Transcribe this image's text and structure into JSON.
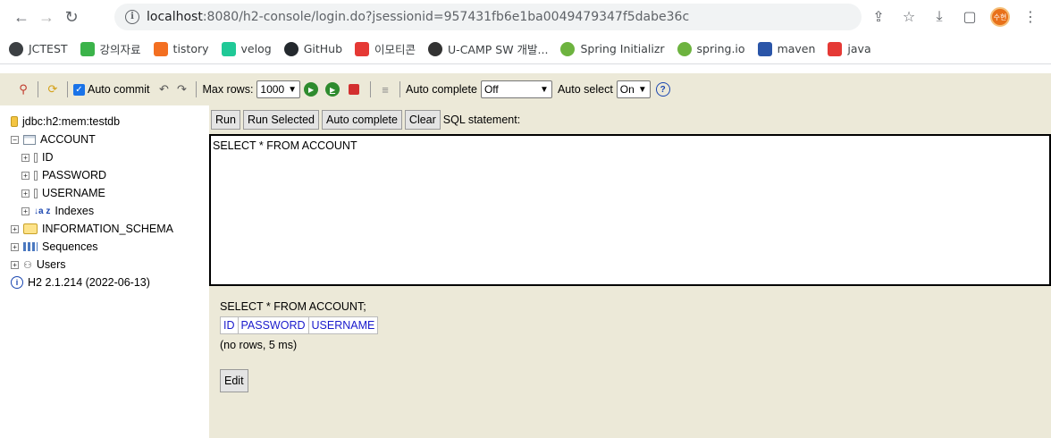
{
  "browser": {
    "url_host": "localhost",
    "url_rest": ":8080/h2-console/login.do?jsessionid=957431fb6e1ba0049479347f5dabe36c",
    "avatar_label": "수현"
  },
  "bookmarks": [
    {
      "label": "JCTEST",
      "color": "#3c4043",
      "icon": "globe-icon"
    },
    {
      "label": "강의자료",
      "color": "#3bb34a",
      "icon": "naver-icon"
    },
    {
      "label": "tistory",
      "color": "#f36f21",
      "icon": "tistory-icon"
    },
    {
      "label": "velog",
      "color": "#20c997",
      "icon": "velog-icon"
    },
    {
      "label": "GitHub",
      "color": "#24292e",
      "icon": "github-icon"
    },
    {
      "label": "이모티콘",
      "color": "#e53935",
      "icon": "emoticon-icon"
    },
    {
      "label": "U-CAMP SW 개발...",
      "color": "#333333",
      "icon": "ucamp-icon"
    },
    {
      "label": "Spring Initializr",
      "color": "#6db33f",
      "icon": "spring-icon"
    },
    {
      "label": "spring.io",
      "color": "#6db33f",
      "icon": "spring-icon"
    },
    {
      "label": "maven",
      "color": "#2a55a8",
      "icon": "maven-icon"
    },
    {
      "label": "java",
      "color": "#e53935",
      "icon": "java-icon"
    }
  ],
  "toolbar": {
    "auto_commit_label": "Auto commit",
    "max_rows_label": "Max rows:",
    "max_rows_value": "1000",
    "auto_complete_label": "Auto complete",
    "auto_complete_value": "Off",
    "auto_select_label": "Auto select",
    "auto_select_value": "On",
    "help_glyph": "?"
  },
  "tree": {
    "connection": "jdbc:h2:mem:testdb",
    "table": "ACCOUNT",
    "columns": [
      "ID",
      "PASSWORD",
      "USERNAME"
    ],
    "indexes": "Indexes",
    "info_schema": "INFORMATION_SCHEMA",
    "sequences": "Sequences",
    "users": "Users",
    "version": "H2 2.1.214 (2022-06-13)"
  },
  "sql_buttons": {
    "run": "Run",
    "run_selected": "Run Selected",
    "auto_complete": "Auto complete",
    "clear": "Clear",
    "sql_label": "SQL statement:"
  },
  "sql_text": "SELECT * FROM ACCOUNT",
  "result": {
    "statement": "SELECT * FROM ACCOUNT;",
    "columns": [
      "ID",
      "PASSWORD",
      "USERNAME"
    ],
    "meta": "(no rows, 5 ms)",
    "edit": "Edit"
  }
}
